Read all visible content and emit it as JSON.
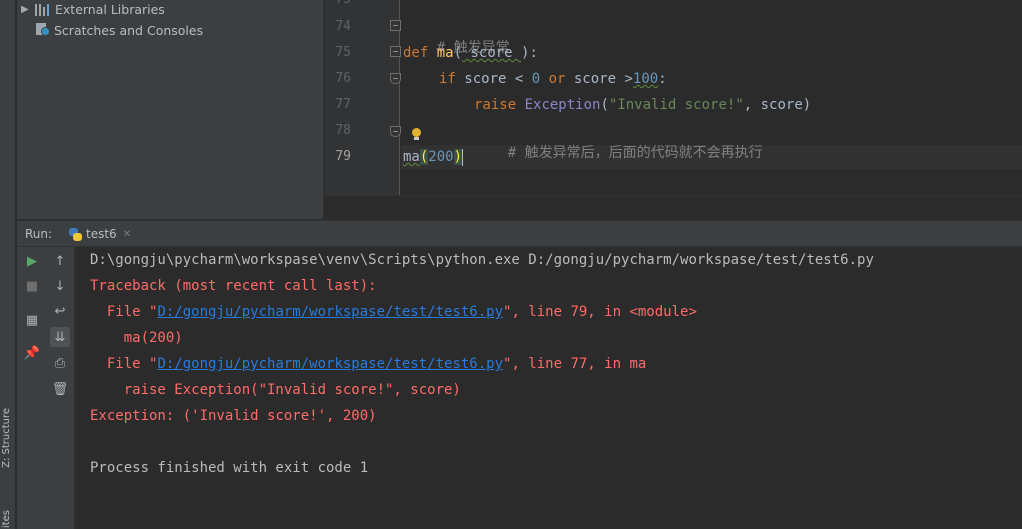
{
  "side_strip": {
    "structure_label": "Z: Structure",
    "favorites_label": "ites"
  },
  "project_tree": {
    "items": [
      {
        "label": "External Libraries",
        "icon": "library-icon",
        "expandable": true
      },
      {
        "label": "Scratches and Consoles",
        "icon": "scratches-icon",
        "expandable": false
      }
    ]
  },
  "editor": {
    "line_numbers": [
      "73",
      "74",
      "75",
      "76",
      "77",
      "78",
      "79"
    ],
    "current_line": "79",
    "lines": {
      "l74_comment": "# 触发异常",
      "l75_def": "def",
      "l75_name": "ma",
      "l75_open": "(",
      "l75_param": " score ",
      "l75_close": "):",
      "l76_if": "if",
      "l76_a": " score < ",
      "l76_zero": "0",
      "l76_or": "or",
      "l76_b": " score >",
      "l76_hundred": "100",
      "l76_colon": ":",
      "l77_raise": "raise",
      "l77_exc": "Exception",
      "l77_open": "(",
      "l77_str": "\"Invalid score!\"",
      "l77_rest": ", score)",
      "l78_comment": "# 触发异常后，后面的代码就不会再执行",
      "l79_call": "ma",
      "l79_open": "(",
      "l79_num": "200",
      "l79_close": ")"
    }
  },
  "run": {
    "label": "Run:",
    "tab_title": "test6",
    "tab_icon": "python-icon",
    "console_lines": [
      {
        "type": "normal",
        "text": "D:\\gongju\\pycharm\\workspase\\venv\\Scripts\\python.exe D:/gongju/pycharm/workspase/test/test6.py"
      },
      {
        "type": "error",
        "text": "Traceback (most recent call last):"
      },
      {
        "type": "error-link",
        "prefix": "  File \"",
        "link": "D:/gongju/pycharm/workspase/test/test6.py",
        "suffix": "\", line 79, in <module>"
      },
      {
        "type": "error",
        "text": "    ma(200)"
      },
      {
        "type": "error-link",
        "prefix": "  File \"",
        "link": "D:/gongju/pycharm/workspase/test/test6.py",
        "suffix": "\", line 77, in ma"
      },
      {
        "type": "error",
        "text": "    raise Exception(\"Invalid score!\", score)"
      },
      {
        "type": "error",
        "text": "Exception: ('Invalid score!', 200)"
      },
      {
        "type": "normal",
        "text": ""
      },
      {
        "type": "normal",
        "text": "Process finished with exit code 1"
      }
    ]
  },
  "colors": {
    "editor_bg": "#2b2b2b",
    "panel_bg": "#3c3f41",
    "keyword": "#cc7832",
    "function": "#ffc66d",
    "number": "#6897bb",
    "string": "#6a8759",
    "error": "#ff6b68",
    "link": "#287bde"
  }
}
